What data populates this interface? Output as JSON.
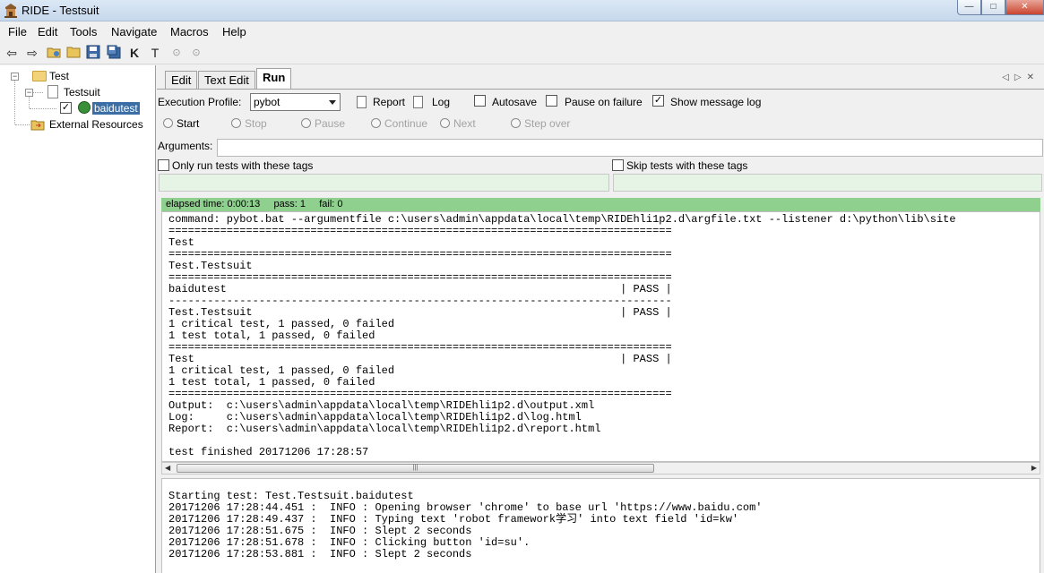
{
  "window": {
    "title": "RIDE - Testsuit",
    "minimize": "—",
    "maximize": "□",
    "close": "✕"
  },
  "menu": [
    "File",
    "Edit",
    "Tools",
    "Navigate",
    "Macros",
    "Help"
  ],
  "toolbar": {
    "icons": [
      "back-icon",
      "forward-icon",
      "open-suite-icon",
      "open-directory-icon",
      "save-icon",
      "save-all-icon",
      "search-keywords-icon",
      "search-tests-icon",
      "run-icon",
      "stop-icon"
    ],
    "keyword_glyph": "K",
    "tests_glyph": "T"
  },
  "tree": {
    "root": "Test",
    "suite": "Testsuit",
    "test": "baidutest",
    "test_checked": true,
    "external": "External Resources"
  },
  "tabs": [
    "Edit",
    "Text Edit",
    "Run"
  ],
  "active_tab": "Run",
  "run": {
    "execution_profile_label": "Execution Profile:",
    "execution_profile_value": "pybot",
    "report_label": "Report",
    "log_label": "Log",
    "autosave_label": "Autosave",
    "autosave_checked": false,
    "pause_on_failure_label": "Pause on failure",
    "pause_on_failure_checked": false,
    "show_message_log_label": "Show message log",
    "show_message_log_checked": true,
    "buttons": {
      "start": "Start",
      "stop": "Stop",
      "pause": "Pause",
      "continue": "Continue",
      "next": "Next",
      "step_over": "Step over"
    },
    "arguments_label": "Arguments:",
    "arguments_value": "",
    "only_run_tags_label": "Only run tests with these tags",
    "skip_tags_label": "Skip tests with these tags",
    "status": {
      "elapsed": "elapsed time: 0:00:13",
      "pass": "pass: 1",
      "fail": "fail: 0",
      "color": "#8fd08f"
    },
    "console_lines": [
      "command: pybot.bat --argumentfile c:\\users\\admin\\appdata\\local\\temp\\RIDEhli1p2.d\\argfile.txt --listener d:\\python\\lib\\site",
      "==============================================================================",
      "Test",
      "==============================================================================",
      "Test.Testsuit",
      "==============================================================================",
      "baidutest                                                             | PASS |",
      "------------------------------------------------------------------------------",
      "Test.Testsuit                                                         | PASS |",
      "1 critical test, 1 passed, 0 failed",
      "1 test total, 1 passed, 0 failed",
      "==============================================================================",
      "Test                                                                  | PASS |",
      "1 critical test, 1 passed, 0 failed",
      "1 test total, 1 passed, 0 failed",
      "==============================================================================",
      "Output:  c:\\users\\admin\\appdata\\local\\temp\\RIDEhli1p2.d\\output.xml",
      "Log:     c:\\users\\admin\\appdata\\local\\temp\\RIDEhli1p2.d\\log.html",
      "Report:  c:\\users\\admin\\appdata\\local\\temp\\RIDEhli1p2.d\\report.html",
      "",
      "test finished 20171206 17:28:57"
    ],
    "message_log_lines": [
      "Starting test: Test.Testsuit.baidutest",
      "20171206 17:28:44.451 :  INFO : Opening browser 'chrome' to base url 'https://www.baidu.com'",
      "20171206 17:28:49.437 :  INFO : Typing text 'robot framework学习' into text field 'id=kw'",
      "20171206 17:28:51.675 :  INFO : Slept 2 seconds",
      "20171206 17:28:51.678 :  INFO : Clicking button 'id=su'.",
      "20171206 17:28:53.881 :  INFO : Slept 2 seconds"
    ]
  }
}
